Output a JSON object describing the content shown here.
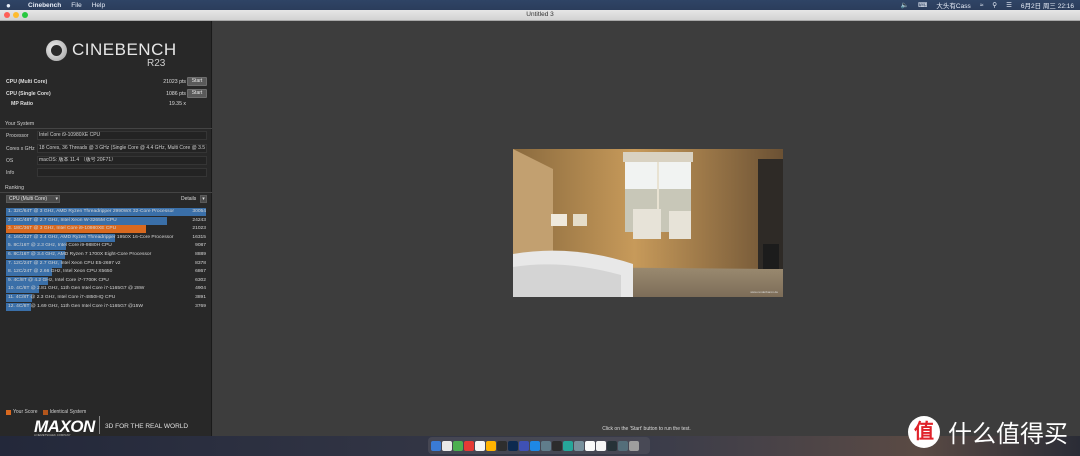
{
  "menubar": {
    "apple": "",
    "items": [
      "Cinebench",
      "File",
      "Help"
    ],
    "input_method": "大头有Cass",
    "datetime": "6月2日 周三  22:16"
  },
  "window": {
    "title": "Untitled 3"
  },
  "logo": {
    "name": "CINEBENCH",
    "version": "R23"
  },
  "scores": {
    "multi": {
      "label": "CPU (Multi Core)",
      "value": "21023 pts",
      "button": "Start"
    },
    "single": {
      "label": "CPU (Single Core)",
      "value": "1086 pts",
      "button": "Start"
    },
    "ratio": {
      "label": "MP Ratio",
      "value": "19.35 x"
    }
  },
  "system": {
    "header": "Your System",
    "rows": [
      {
        "key": "Processor",
        "value": "Intel Core i9-10980XE CPU"
      },
      {
        "key": "Cores x GHz",
        "value": "18 Cores, 36 Threads @ 3 GHz (Single Core @ 4.4 GHz, Multi Core @ 3.5 GHz)"
      },
      {
        "key": "OS",
        "value": "macOS: 版本 11.4 （版号 20F71）"
      },
      {
        "key": "Info",
        "value": ""
      }
    ]
  },
  "ranking": {
    "header": "Ranking",
    "dropdown": "CPU (Multi Core)",
    "details": "Details",
    "rows": [
      {
        "label": "1. 32C/64T @ 3 GHz, AMD Ryzen Threadripper 2990WX 32-Core Processor",
        "score": "30054",
        "fraction": 1.0,
        "color": "#3a6fa8"
      },
      {
        "label": "2. 24C/48T @ 2.7 GHz, Intel Xeon W-3265M CPU",
        "score": "24243",
        "fraction": 0.807,
        "color": "#3a6fa8"
      },
      {
        "label": "3. 18C/36T @ 3 GHz, Intel Core i9-10980XE CPU",
        "score": "21023",
        "fraction": 0.7,
        "color": "#d9691f"
      },
      {
        "label": "4. 16C/32T @ 3.4 GHz, AMD Ryzen Threadripper 1950X 16-Core Processor",
        "score": "16315",
        "fraction": 0.543,
        "color": "#3a6fa8"
      },
      {
        "label": "5. 8C/16T @ 2.3 GHz, Intel Core i9-9880H CPU",
        "score": "9087",
        "fraction": 0.302,
        "color": "#3a6fa8"
      },
      {
        "label": "6. 8C/16T @ 3.4 GHz, AMD Ryzen 7 1700X Eight-Core Processor",
        "score": "8889",
        "fraction": 0.296,
        "color": "#3a6fa8"
      },
      {
        "label": "7. 12C/24T @ 2.7 GHz, Intel Xeon CPU E5-2697 v2",
        "score": "8378",
        "fraction": 0.279,
        "color": "#3a6fa8"
      },
      {
        "label": "8. 12C/24T @ 2.66 GHz, Intel Xeon CPU X5650",
        "score": "6867",
        "fraction": 0.228,
        "color": "#3a6fa8"
      },
      {
        "label": "9. 4C/8T @ 4.2 GHz, Intel Core i7-7700K CPU",
        "score": "6302",
        "fraction": 0.21,
        "color": "#3a6fa8"
      },
      {
        "label": "10. 4C/8T @ 2.81 GHz, 11th Gen Intel Core i7-1165G7 @ 28W",
        "score": "4904",
        "fraction": 0.163,
        "color": "#3a6fa8"
      },
      {
        "label": "11. 4C/8T @ 2.3 GHz, Intel Core i7-4850HQ CPU",
        "score": "3891",
        "fraction": 0.129,
        "color": "#3a6fa8"
      },
      {
        "label": "12. 4C/8T @ 1.69 GHz, 11th Gen Intel Core i7-1165G7 @15W",
        "score": "3769",
        "fraction": 0.125,
        "color": "#3a6fa8"
      }
    ]
  },
  "legend": {
    "your_score": "Your Score",
    "identical": "Identical System",
    "your_color": "#d9691f",
    "identical_color": "#b3561c"
  },
  "footer": {
    "brand": "MAXON",
    "brand_sub": "A NEMETSCHEK COMPANY",
    "tagline": "3D FOR THE REAL WORLD"
  },
  "hint": "Click on the 'Start' button to run the test.",
  "render_caption": "www.renderbaron.de",
  "watermark": {
    "badge": "值",
    "text": "什么值得买"
  }
}
